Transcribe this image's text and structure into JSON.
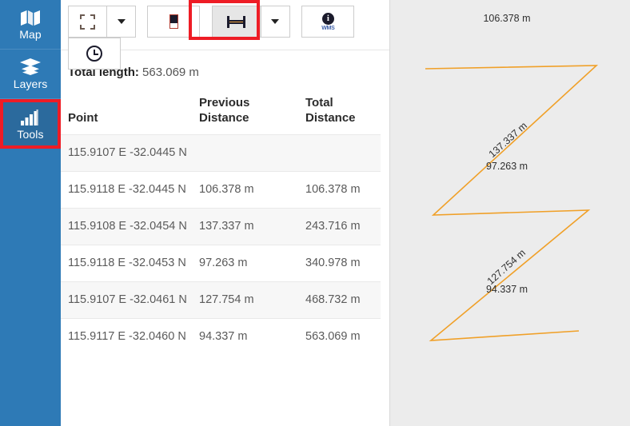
{
  "sidebar": {
    "items": [
      {
        "label": "Map",
        "icon": "map-icon",
        "active": false
      },
      {
        "label": "Layers",
        "icon": "layers-icon",
        "active": false
      },
      {
        "label": "Tools",
        "icon": "chart-bars-icon",
        "active": true
      }
    ]
  },
  "toolbar": {
    "buttons": [
      {
        "name": "select-rectangle-button",
        "icon": "dashed-rectangle-icon",
        "tooltip": "Select"
      },
      {
        "name": "select-dropdown-button",
        "icon": "chevron-down-icon",
        "tooltip": "Select options"
      },
      {
        "name": "legend-button",
        "icon": "legend-icon",
        "tooltip": "Legend"
      },
      {
        "name": "measure-distance-button",
        "icon": "ruler-icon",
        "tooltip": "Measure distance"
      },
      {
        "name": "measure-dropdown-button",
        "icon": "chevron-down-icon",
        "tooltip": "Measure options"
      },
      {
        "name": "wms-info-button",
        "icon": "info-wms-icon",
        "tooltip": "WMS feature info"
      },
      {
        "name": "time-button",
        "icon": "clock-icon",
        "tooltip": "Time"
      }
    ],
    "wms_label": "WMS",
    "info_glyph": "i",
    "highlight_color": "#ee1c25"
  },
  "measure": {
    "total_length_label": "Total length:",
    "total_length_value": "563.069 m",
    "columns": [
      "Point",
      "Previous Distance",
      "Total Distance"
    ],
    "column_lines": [
      [
        "",
        "Point"
      ],
      [
        "Previous",
        "Distance"
      ],
      [
        "Total",
        "Distance"
      ]
    ],
    "rows": [
      {
        "point": "115.9107 E -32.0445 N",
        "previous": "",
        "total": ""
      },
      {
        "point": "115.9118 E -32.0445 N",
        "previous": "106.378 m",
        "total": "106.378 m"
      },
      {
        "point": "115.9108 E -32.0454 N",
        "previous": "137.337 m",
        "total": "243.716 m"
      },
      {
        "point": "115.9118 E -32.0453 N",
        "previous": "97.263 m",
        "total": "340.978 m"
      },
      {
        "point": "115.9107 E -32.0461 N",
        "previous": "127.754 m",
        "total": "468.732 m"
      },
      {
        "point": "115.9117 E -32.0460 N",
        "previous": "94.337 m",
        "total": "563.069 m"
      }
    ]
  },
  "map": {
    "background_color": "#ececec",
    "line_color": "#f0a028",
    "segment_labels": [
      "106.378 m",
      "137.337 m",
      "97.263 m",
      "127.754 m",
      "94.337 m"
    ],
    "label_rotations": [
      0,
      -57,
      0,
      -57,
      0
    ]
  }
}
